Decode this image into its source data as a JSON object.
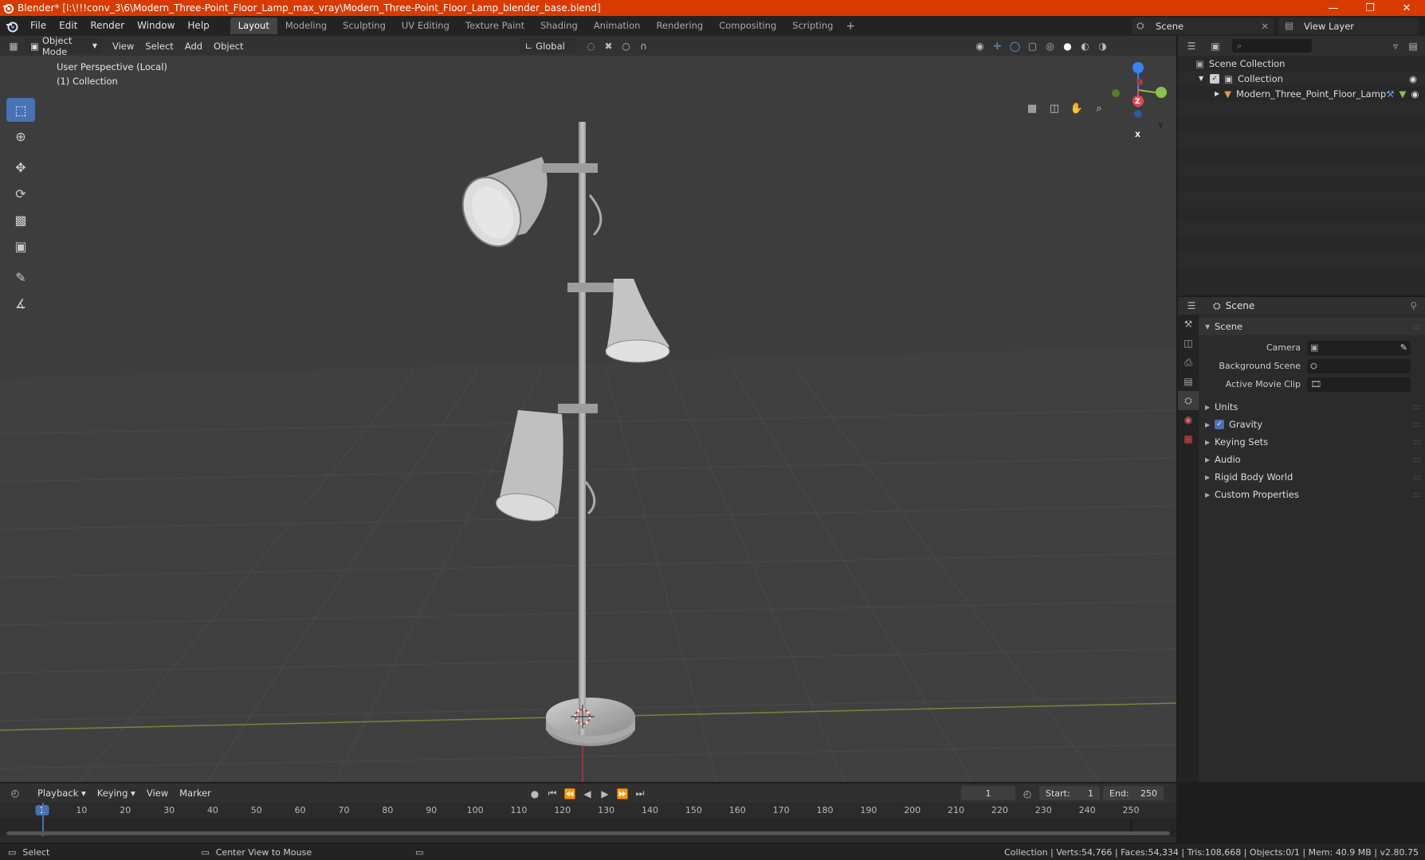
{
  "window": {
    "title": "Blender* [I:\\!!!conv_3\\6\\Modern_Three-Point_Floor_Lamp_max_vray\\Modern_Three-Point_Floor_Lamp_blender_base.blend]",
    "minimize": "—",
    "maximize": "❐",
    "close": "✕"
  },
  "menu": {
    "items": [
      "File",
      "Edit",
      "Render",
      "Window",
      "Help"
    ],
    "workspaces": [
      "Layout",
      "Modeling",
      "Sculpting",
      "UV Editing",
      "Texture Paint",
      "Shading",
      "Animation",
      "Rendering",
      "Compositing",
      "Scripting"
    ],
    "active_workspace": "Layout",
    "add_workspace": "+",
    "scene": "Scene",
    "view_layer": "View Layer"
  },
  "viewport": {
    "mode": "Object Mode",
    "menus": [
      "View",
      "Select",
      "Add",
      "Object"
    ],
    "orientation": "Global",
    "perspective_label": "User Perspective (Local)",
    "collection_label": "(1) Collection",
    "gizmo_axes": {
      "z": "Z",
      "y": "Y",
      "x": "X"
    }
  },
  "toolbar": {
    "tools": [
      "select-box",
      "cursor",
      "move",
      "rotate",
      "scale",
      "transform",
      "annotate",
      "measure"
    ]
  },
  "outliner": {
    "search_placeholder": "",
    "root": "Scene Collection",
    "collection": "Collection",
    "object": "Modern_Three_Point_Floor_Lamp"
  },
  "properties": {
    "context": "Scene",
    "panel_title": "Scene",
    "fields": [
      {
        "label": "Camera",
        "value": ""
      },
      {
        "label": "Background Scene",
        "value": ""
      },
      {
        "label": "Active Movie Clip",
        "value": ""
      }
    ],
    "subpanels": [
      "Units",
      "Gravity",
      "Keying Sets",
      "Audio",
      "Rigid Body World",
      "Custom Properties"
    ],
    "gravity_checked": true
  },
  "timeline": {
    "menus": [
      "Playback",
      "Keying",
      "View",
      "Marker"
    ],
    "current_frame": "1",
    "start_label": "Start:",
    "start": "1",
    "end_label": "End:",
    "end": "250",
    "ticks": [
      "1",
      "10",
      "20",
      "30",
      "40",
      "50",
      "60",
      "70",
      "80",
      "90",
      "100",
      "110",
      "120",
      "130",
      "140",
      "150",
      "160",
      "170",
      "180",
      "190",
      "200",
      "210",
      "220",
      "230",
      "240",
      "250"
    ]
  },
  "status": {
    "select": "Select",
    "center": "Center View to Mouse",
    "stats": "Collection | Verts:54,766 | Faces:54,334 | Tris:108,668 | Objects:0/1 | Mem: 40.9 MB | v2.80.75"
  },
  "colors": {
    "titlebar": "#d83b01",
    "accent": "#4772b3",
    "x_axis": "#e04858",
    "y_axis": "#8bc34a",
    "z_axis": "#3b82f6"
  }
}
